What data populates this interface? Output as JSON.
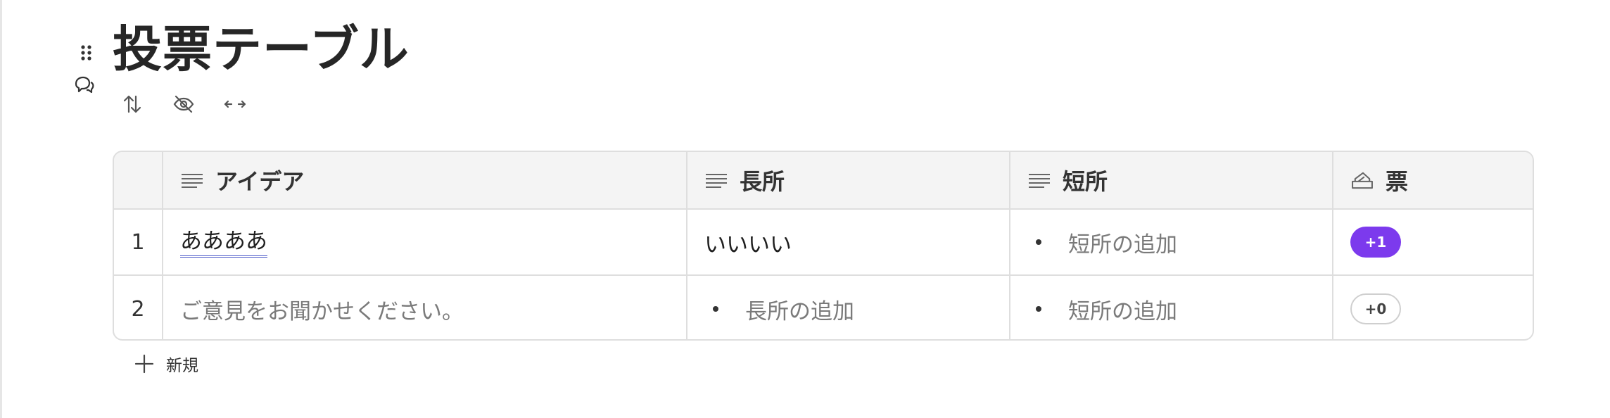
{
  "page": {
    "title": "投票テーブル"
  },
  "toolbar": {
    "icons": [
      "sort-icon",
      "hide-icon",
      "column-width-icon"
    ]
  },
  "table": {
    "columns": [
      {
        "label": "アイデア",
        "icon": "text-lines-icon"
      },
      {
        "label": "長所",
        "icon": "text-lines-icon"
      },
      {
        "label": "短所",
        "icon": "text-lines-icon"
      },
      {
        "label": "票",
        "icon": "ballot-box-icon"
      }
    ],
    "rows": [
      {
        "number": "1",
        "idea": "ああああ",
        "pros": "いいいい",
        "cons_placeholder": "短所の追加",
        "votes": "+1",
        "voted": true
      },
      {
        "number": "2",
        "idea_placeholder": "ご意見をお聞かせください。",
        "pros_placeholder": "長所の追加",
        "cons_placeholder": "短所の追加",
        "votes": "+0",
        "voted": false
      }
    ],
    "add_label": "新規"
  },
  "colors": {
    "vote_active": "#7c3aed",
    "border": "#dedede",
    "header_bg": "#f4f4f4",
    "spellcheck_underline": "#4a57c8"
  }
}
